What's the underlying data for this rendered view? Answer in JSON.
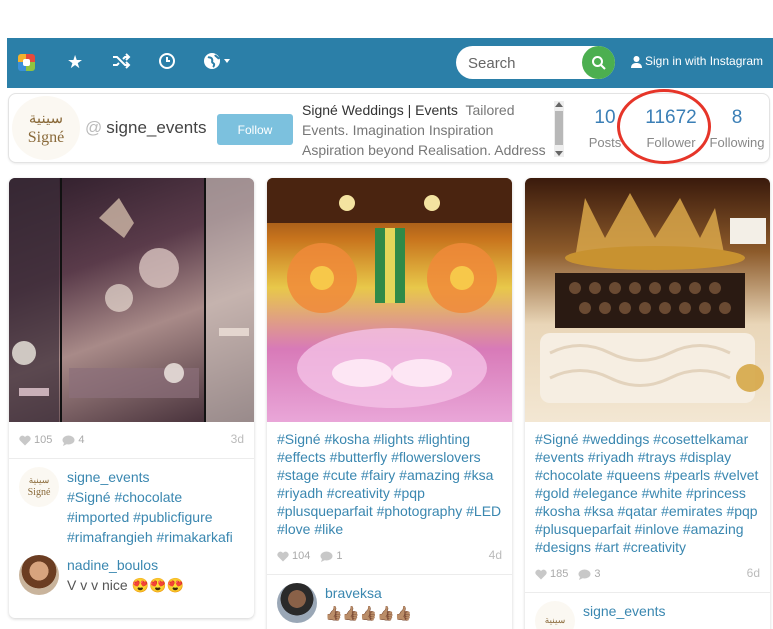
{
  "nav": {
    "search_placeholder": "Search",
    "signin_label": "Sign in with Instagram",
    "icons": [
      "app-logo",
      "star-icon",
      "shuffle-icon",
      "clock-icon",
      "globe-icon"
    ]
  },
  "profile": {
    "brand_ar": "سينية",
    "brand_en": "Signé",
    "at": "@",
    "username": "signe_events",
    "follow_label": "Follow",
    "bio_name": "Signé Weddings | Events",
    "bio_text": "Tailored Events. Imagination Inspiration Aspiration beyond Realisation. Address",
    "stats": [
      {
        "num": "10",
        "label": "Posts"
      },
      {
        "num": "11672",
        "label": "Follower"
      },
      {
        "num": "8",
        "label": "Following"
      }
    ]
  },
  "posts": [
    {
      "tags": "",
      "likes": "105",
      "comments": "4",
      "time": "3d",
      "comment_list": [
        {
          "user": "signe_events",
          "text": "#Signé #chocolate #imported #publicfigure #rimafrangieh #rimakarkafi"
        },
        {
          "user": "nadine_boulos",
          "text": "V v v nice 😍😍😍"
        }
      ]
    },
    {
      "tags": "#Signé #kosha #lights #lighting #effects #butterfly #flowerslovers #stage #cute #fairy #amazing #ksa #riyadh #creativity #pqp #plusqueparfait #photography #LED #love #like",
      "likes": "104",
      "comments": "1",
      "time": "4d",
      "comment_list": [
        {
          "user": "braveksa",
          "text": "👍🏽👍🏽👍🏽👍🏽👍🏽"
        }
      ]
    },
    {
      "tags": "#Signé #weddings #cosettelkamar #events #riyadh #trays #display #chocolate #queens #pearls #velvet #gold #elegance #white #princess #kosha #ksa #qatar #emirates #pqp #plusqueparfait #inlove #amazing #designs #art #creativity",
      "likes": "185",
      "comments": "3",
      "time": "6d",
      "comment_list": [
        {
          "user": "signe_events",
          "text": ""
        }
      ]
    }
  ],
  "colors": {
    "navbar": "#2b7fa8",
    "link": "#3a87b0",
    "stat": "#3b7fb6",
    "search_button": "#4caf50",
    "follow_button": "#7cc1de",
    "highlight_circle": "#e63529"
  }
}
